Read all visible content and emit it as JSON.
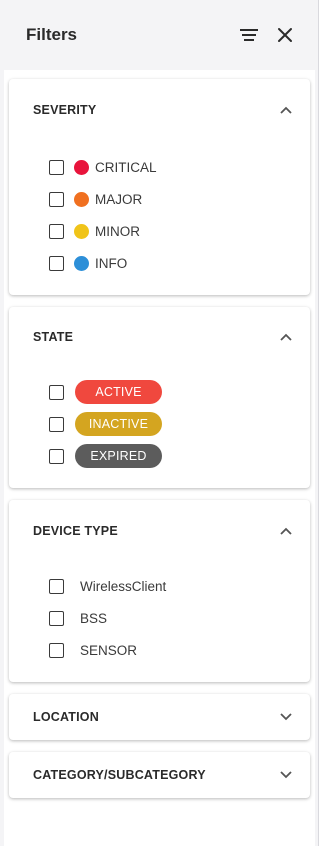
{
  "header": {
    "title": "Filters"
  },
  "sections": {
    "severity": {
      "title": "SEVERITY",
      "options": [
        {
          "label": "CRITICAL",
          "color": "#e8143c"
        },
        {
          "label": "MAJOR",
          "color": "#f07020"
        },
        {
          "label": "MINOR",
          "color": "#f0c419"
        },
        {
          "label": "INFO",
          "color": "#2d8fd8"
        }
      ]
    },
    "state": {
      "title": "STATE",
      "options": [
        {
          "label": "ACTIVE",
          "color": "#f0483e"
        },
        {
          "label": "INACTIVE",
          "color": "#d4a520"
        },
        {
          "label": "EXPIRED",
          "color": "#5c5c5c"
        }
      ]
    },
    "device_type": {
      "title": "DEVICE TYPE",
      "options": [
        {
          "label": "WirelessClient"
        },
        {
          "label": "BSS"
        },
        {
          "label": "SENSOR"
        }
      ]
    },
    "location": {
      "title": "LOCATION"
    },
    "category": {
      "title": "CATEGORY/SUBCATEGORY"
    }
  }
}
